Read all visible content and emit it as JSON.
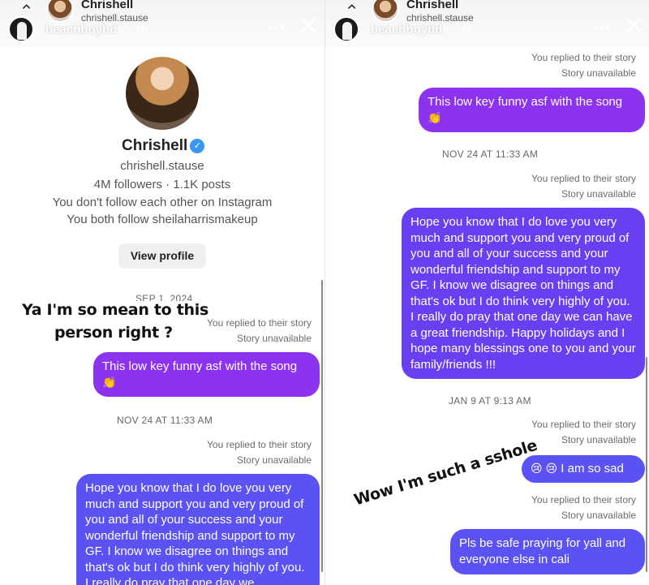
{
  "story": {
    "username": "beachboybd",
    "time": "1h",
    "more": "•••",
    "close": "✕"
  },
  "dm": {
    "name": "Chrishell",
    "handle": "chrishell.stause"
  },
  "profile": {
    "name": "Chrishell",
    "username": "chrishell.stause",
    "stats": "4M followers · 1.1K posts",
    "follow_status": "You don't follow each other on Instagram",
    "mutual": "You both follow sheilaharrismakeup",
    "view_profile": "View profile"
  },
  "left_chat": {
    "date1": "SEP 1, 2024",
    "meta1_line1": "You replied to their story",
    "meta1_line2": "Story unavailable",
    "msg1": "This low key funny asf with the song",
    "msg1_emoji": "👏",
    "date2": "NOV 24 AT 11:33 AM",
    "meta2_line1": "You replied to their story",
    "meta2_line2": "Story unavailable",
    "msg2": "Hope you know that I do love you very much and support you and very proud of you and all of your success and your wonderful friendship and support to my GF. I know we disagree on things and that's ok but I do think very highly of you. I really do pray that one day we"
  },
  "right_chat": {
    "meta0_line1": "You replied to their story",
    "meta0_line2": "Story unavailable",
    "msg1": "This low key funny asf with the song",
    "msg1_emoji": "👏",
    "date1": "NOV 24 AT 11:33 AM",
    "meta1_line1": "You replied to their story",
    "meta1_line2": "Story unavailable",
    "msg2": "Hope you know that I do love you very much and support you and very proud of you and all of your success and your wonderful friendship and support to my GF. I know we disagree on things and that's ok but I do think very highly of you. I really do pray that one day we can have a great friendship. Happy holidays and I hope many blessings one to you and your family/friends !!!",
    "date2": "JAN 9 AT 9:13 AM",
    "meta2_line1": "You replied to their story",
    "meta2_line2": "Story unavailable",
    "msg3_emoji": "😢 😢",
    "msg3": "I am so sad",
    "meta3_line1": "You replied to their story",
    "meta3_line2": "Story unavailable",
    "msg4": "Pls be safe praying for yall and everyone else in cali"
  },
  "captions": {
    "left_line1": "Ya I'm so mean to this",
    "left_line2": "person right ?",
    "right": "Wow I'm such a   sshole"
  }
}
